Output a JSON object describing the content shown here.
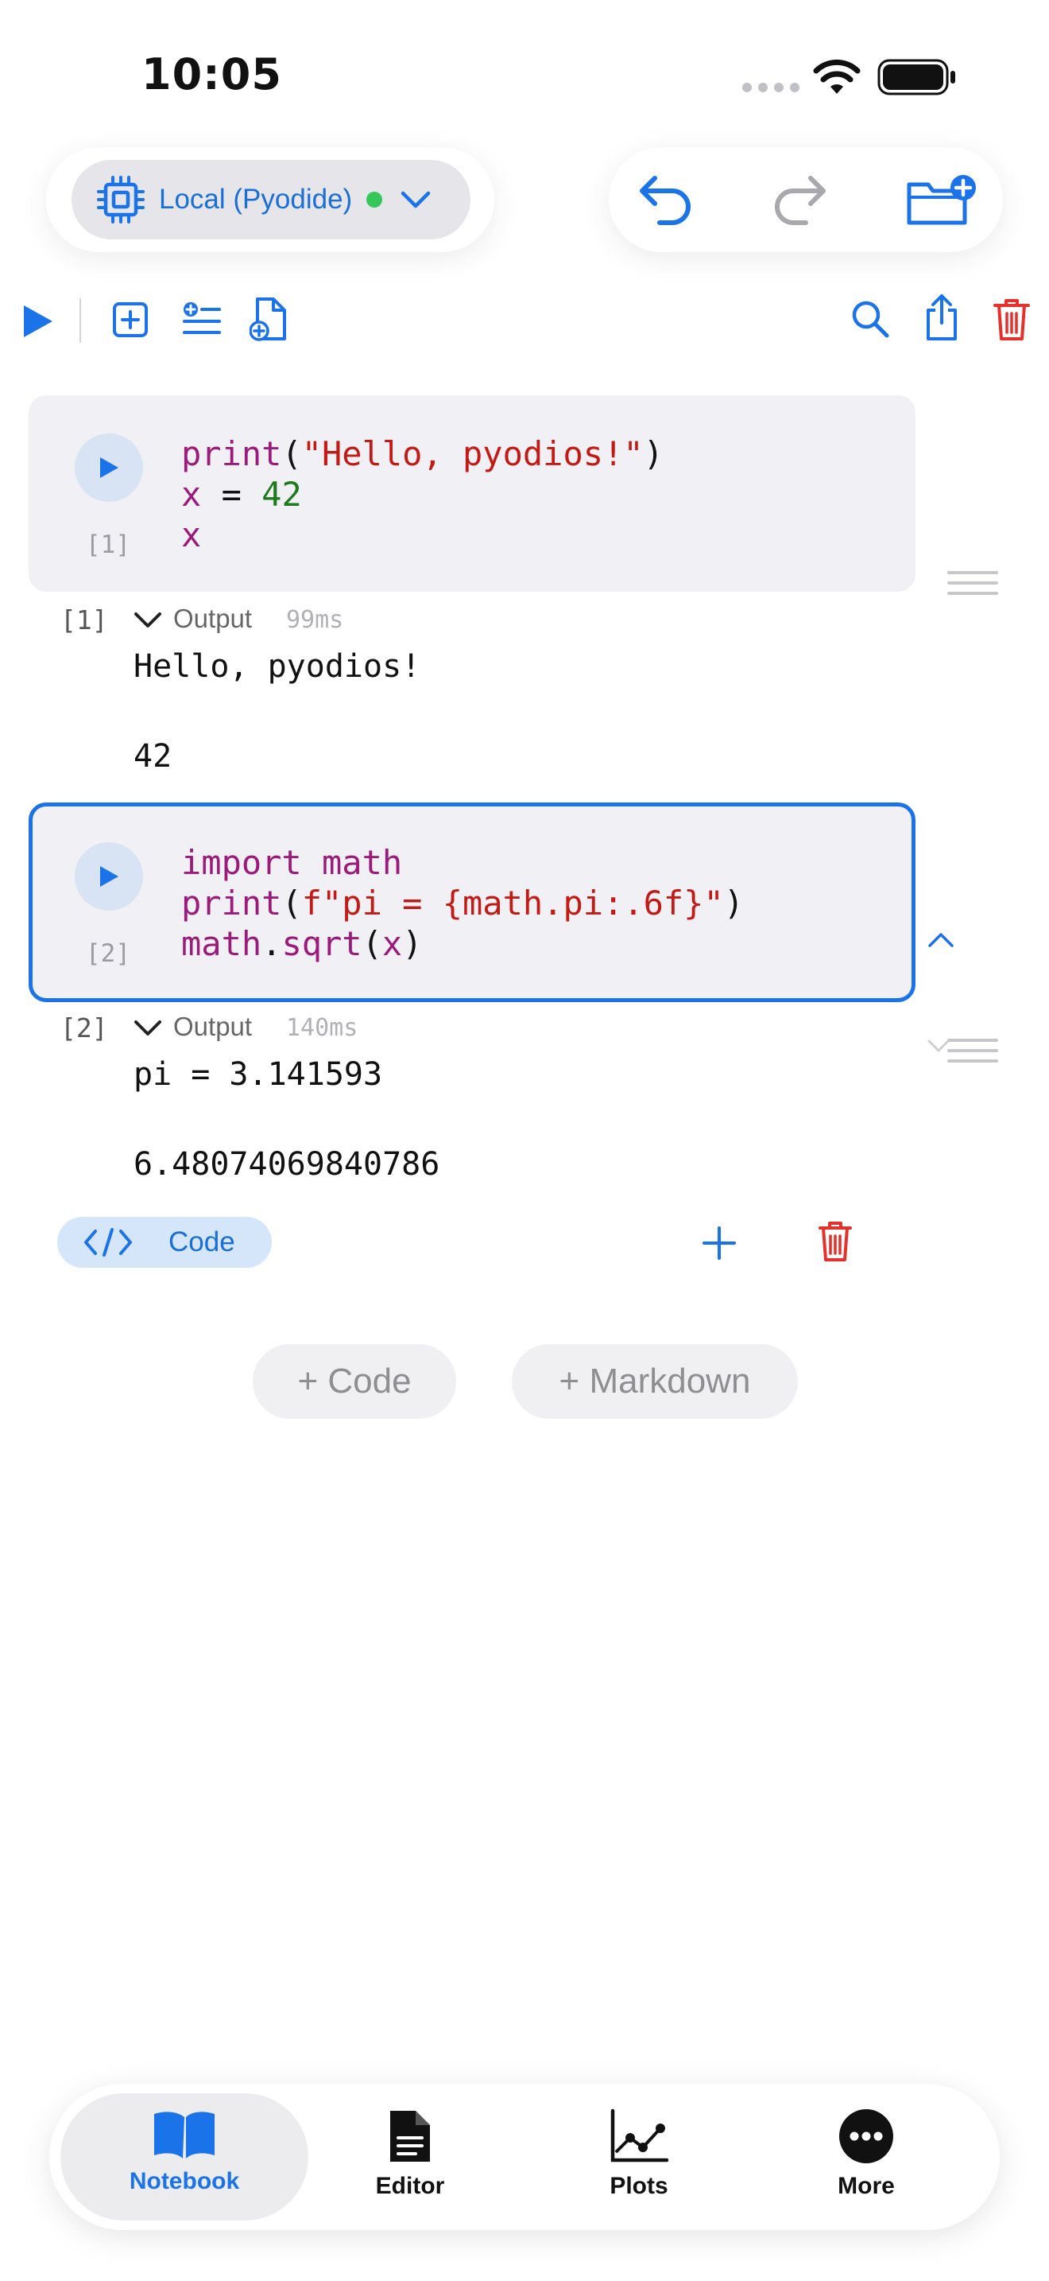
{
  "status_bar": {
    "time": "10:05"
  },
  "kernel": {
    "label": "Local (Pyodide)",
    "status_color": "#35c759"
  },
  "colors": {
    "accent": "#1a73e8",
    "danger": "#e5302c",
    "cell_bg": "#f1f0f5"
  },
  "cells": [
    {
      "exec_label": "[1]",
      "code_lines": [
        "print(\"Hello, pyodios!\")",
        "x = 42",
        "x"
      ],
      "output": {
        "count": "[1]",
        "label": "Output",
        "duration": "99ms",
        "lines": [
          "Hello, pyodios!",
          "42"
        ]
      }
    },
    {
      "exec_label": "[2]",
      "code_lines": [
        "import math",
        "print(f\"pi = {math.pi:.6f}\")",
        "math.sqrt(x)"
      ],
      "output": {
        "count": "[2]",
        "label": "Output",
        "duration": "140ms",
        "lines": [
          "pi = 3.141593",
          "6.48074069840786"
        ]
      }
    }
  ],
  "cell_type_chip": {
    "label": "Code"
  },
  "add_buttons": {
    "code": "+ Code",
    "markdown": "+ Markdown"
  },
  "tabs": [
    {
      "label": "Notebook",
      "icon": "book-icon",
      "active": true
    },
    {
      "label": "Editor",
      "icon": "document-icon",
      "active": false
    },
    {
      "label": "Plots",
      "icon": "chart-icon",
      "active": false
    },
    {
      "label": "More",
      "icon": "ellipsis-icon",
      "active": false
    }
  ]
}
